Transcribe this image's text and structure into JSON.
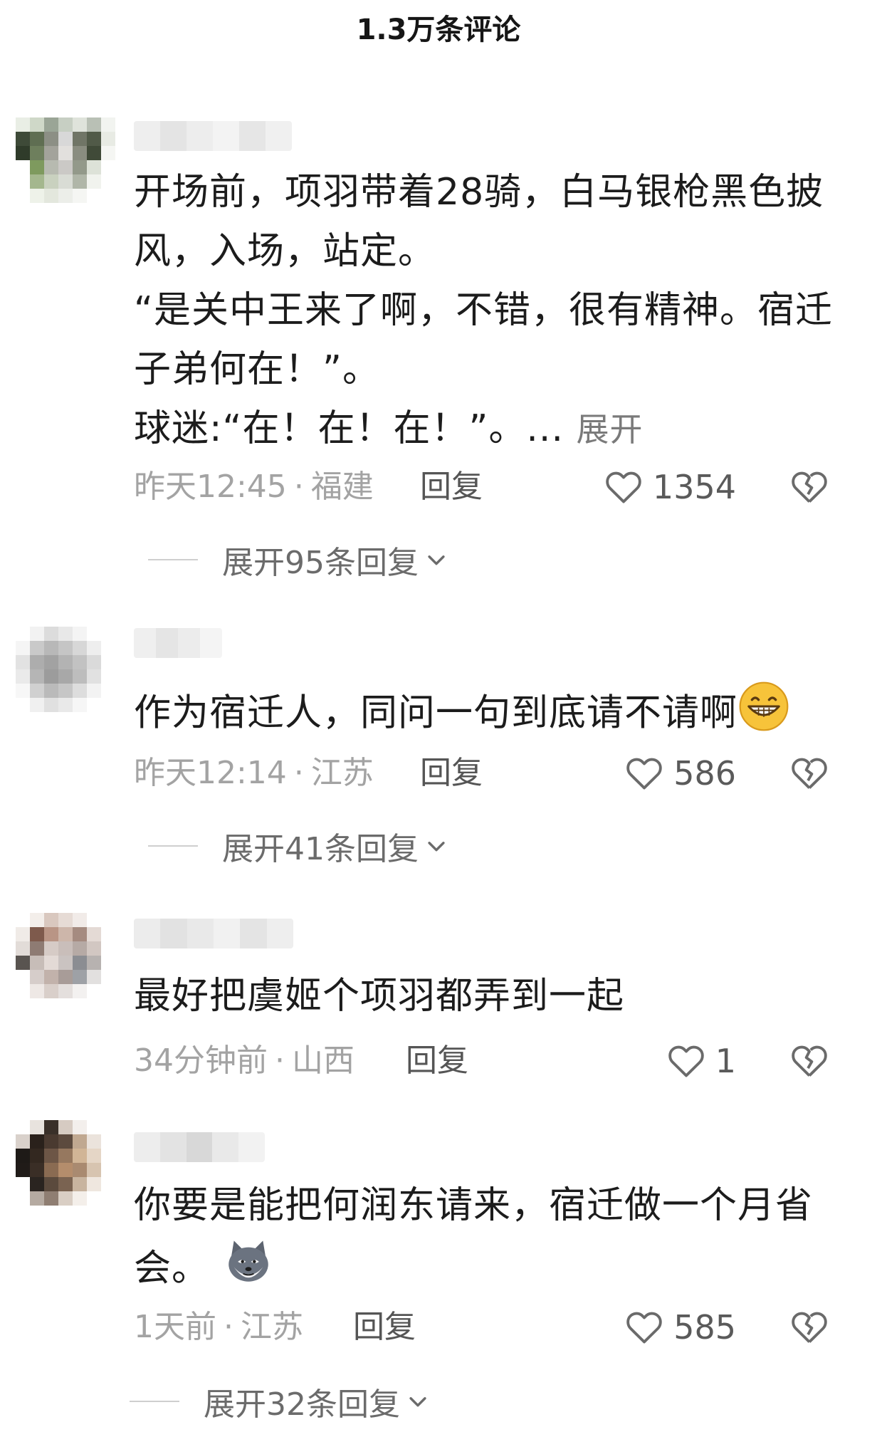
{
  "header": {
    "title": "1.3万条评论"
  },
  "colors": {
    "text": "#1c1c1c",
    "meta": "#a3a3a3",
    "reply": "#555555",
    "like": "#5a5a5a"
  },
  "comments": [
    {
      "lines": [
        "开场前，项羽带着28骑，白马银枪黑色披",
        "风，入场，站定。",
        "“是关中王来了啊，不错，很有精神。宿迁",
        "子弟何在！”。",
        "球迷:“在！在！在！”。..."
      ],
      "expand_label": "展开",
      "time": "昨天12:45",
      "location": "福建",
      "reply_label": "回复",
      "likes": "1354",
      "replies_label": "展开95条回复"
    },
    {
      "lines": [
        "作为宿迁人，同问一句到底请不请啊"
      ],
      "emoji": "grinning-face-emoji",
      "time": "昨天12:14",
      "location": "江苏",
      "reply_label": "回复",
      "likes": "586",
      "replies_label": "展开41条回复"
    },
    {
      "lines": [
        "最好把虞姬个项羽都弄到一起"
      ],
      "time": "34分钟前",
      "location": "山西",
      "reply_label": "回复",
      "likes": "1"
    },
    {
      "lines": [
        "你要是能把何润东请来，宿迁做一个月省",
        "会。"
      ],
      "emoji": "husky-emoji",
      "time": "1天前",
      "location": "江苏",
      "reply_label": "回复",
      "likes": "585",
      "replies_label": "展开32条回复"
    }
  ],
  "icons": {
    "like": "heart-outline-icon",
    "dislike": "broken-heart-icon",
    "expand": "chevron-down-icon"
  }
}
